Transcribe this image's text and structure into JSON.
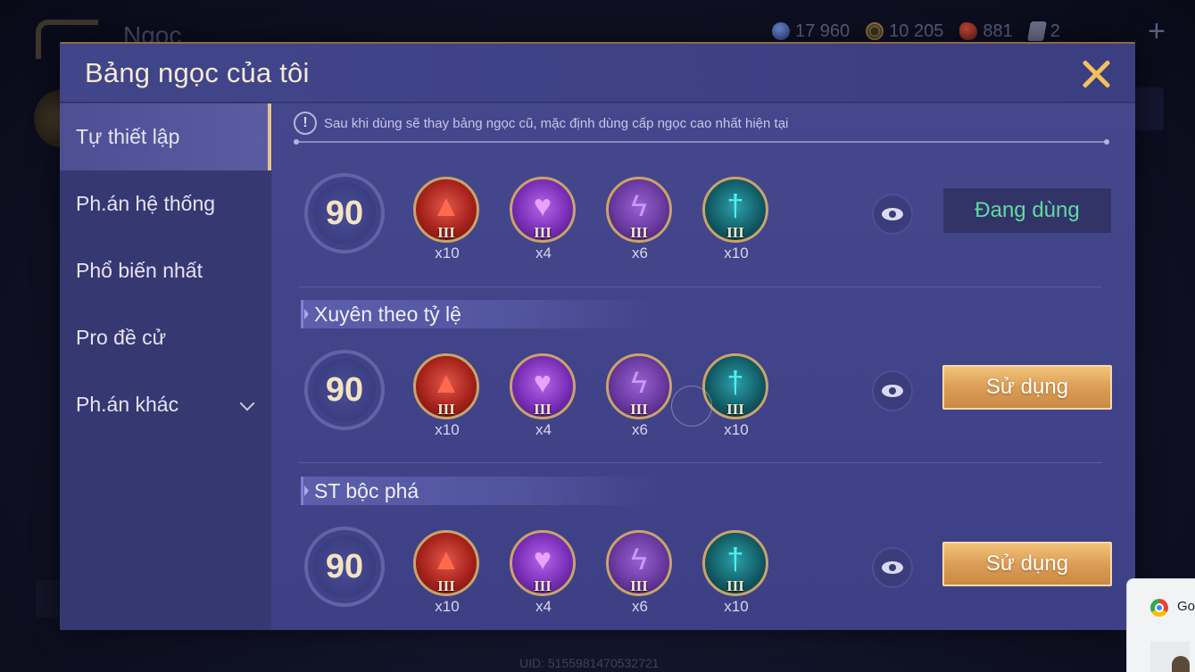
{
  "background": {
    "title": "Ngọc",
    "currencies": [
      {
        "icon": "blue-gem-icon",
        "value": "17 960"
      },
      {
        "icon": "gold-coin-icon",
        "value": "10 205"
      },
      {
        "icon": "red-crystal-icon",
        "value": "881"
      },
      {
        "icon": "card-icon",
        "value": "2"
      }
    ],
    "uid": "UID: 5155981470532721"
  },
  "modal": {
    "title": "Bảng ngọc của tôi",
    "notice": "Sau khi dùng sẽ thay bảng ngọc cũ, mặc định dùng cấp ngọc cao nhất hiện tại",
    "sidebar": [
      {
        "label": "Tự thiết lập",
        "active": true
      },
      {
        "label": "Ph.án hệ thống",
        "active": false
      },
      {
        "label": "Phổ biến nhất",
        "active": false
      },
      {
        "label": "Pro đề cử",
        "active": false
      },
      {
        "label": "Ph.án khác",
        "active": false,
        "expandable": true
      }
    ],
    "sets": [
      {
        "name": "",
        "level": "90",
        "gems": [
          {
            "tier": "III",
            "count": "x10",
            "color": "red"
          },
          {
            "tier": "III",
            "count": "x4",
            "color": "purple"
          },
          {
            "tier": "III",
            "count": "x6",
            "color": "violet"
          },
          {
            "tier": "III",
            "count": "x10",
            "color": "teal"
          }
        ],
        "action": "Đang dùng",
        "in_use": true
      },
      {
        "name": "Xuyên theo tỷ lệ",
        "level": "90",
        "gems": [
          {
            "tier": "III",
            "count": "x10",
            "color": "red"
          },
          {
            "tier": "III",
            "count": "x4",
            "color": "purple"
          },
          {
            "tier": "III",
            "count": "x6",
            "color": "violet"
          },
          {
            "tier": "III",
            "count": "x10",
            "color": "teal"
          }
        ],
        "action": "Sử dụng",
        "in_use": false
      },
      {
        "name": "ST bộc phá",
        "level": "90",
        "gems": [
          {
            "tier": "III",
            "count": "x10",
            "color": "red"
          },
          {
            "tier": "III",
            "count": "x4",
            "color": "purple"
          },
          {
            "tier": "III",
            "count": "x6",
            "color": "violet"
          },
          {
            "tier": "III",
            "count": "x10",
            "color": "teal"
          }
        ],
        "action": "Sử dụng",
        "in_use": false
      }
    ]
  },
  "chrome_popup": {
    "text": "Go"
  },
  "colors": {
    "accent_gold": "#f4c15a",
    "in_use_green": "#62d9a2",
    "panel": "#3d3f80"
  }
}
